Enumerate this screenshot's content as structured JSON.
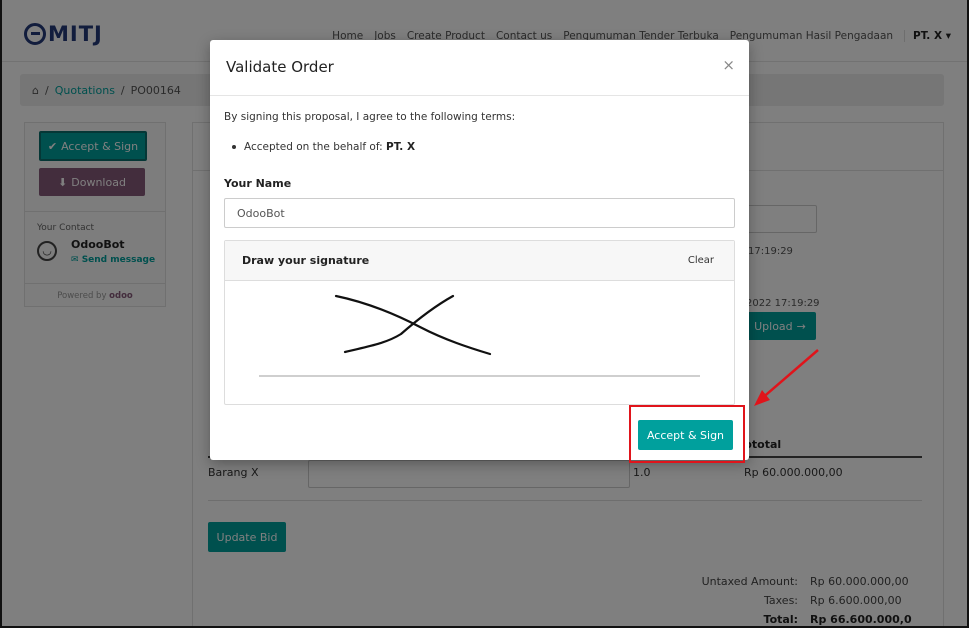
{
  "navbar": {
    "logo": "MITJ",
    "links": [
      "Home",
      "Jobs",
      "Create Product",
      "Contact us",
      "Pengumuman Tender Terbuka",
      "Pengumuman Hasil Pengadaan"
    ],
    "user": "PT. X"
  },
  "breadcrumb": {
    "home_icon": "home-icon",
    "items": [
      "Quotations",
      "PO00164"
    ]
  },
  "sidebar": {
    "accept_sign": "Accept & Sign",
    "download": "Download",
    "contact_title": "Your Contact",
    "contact_name": "OdooBot",
    "send_message": "Send message",
    "powered_by": "Powered by",
    "powered_brand": "odoo"
  },
  "background": {
    "date1": "17:19:29",
    "date2": "2022 17:19:29",
    "upload_label": "Upload",
    "col_subtotal": "btotal",
    "row": {
      "name": "Barang X",
      "qty": "1.0",
      "subtotal": "Rp 60.000.000,00"
    },
    "update_bid": "Update Bid",
    "totals": [
      {
        "label": "Untaxed Amount:",
        "value": "Rp 60.000.000,00"
      },
      {
        "label": "Taxes:",
        "value": "Rp 6.600.000,00"
      },
      {
        "label": "Total:",
        "value": "Rp 66.600.000,0"
      }
    ]
  },
  "modal": {
    "title": "Validate Order",
    "close": "×",
    "terms_intro": "By signing this proposal, I agree to the following terms:",
    "accepted_prefix": "Accepted on the behalf of: ",
    "accepted_company": "PT. X",
    "name_label": "Your Name",
    "name_value": "OdooBot",
    "draw_signature": "Draw your signature",
    "clear": "Clear",
    "accept_sign": "Accept & Sign"
  },
  "colors": {
    "primary": "#00a09d",
    "secondary": "#875a7b",
    "annotation": "#e0141b"
  }
}
